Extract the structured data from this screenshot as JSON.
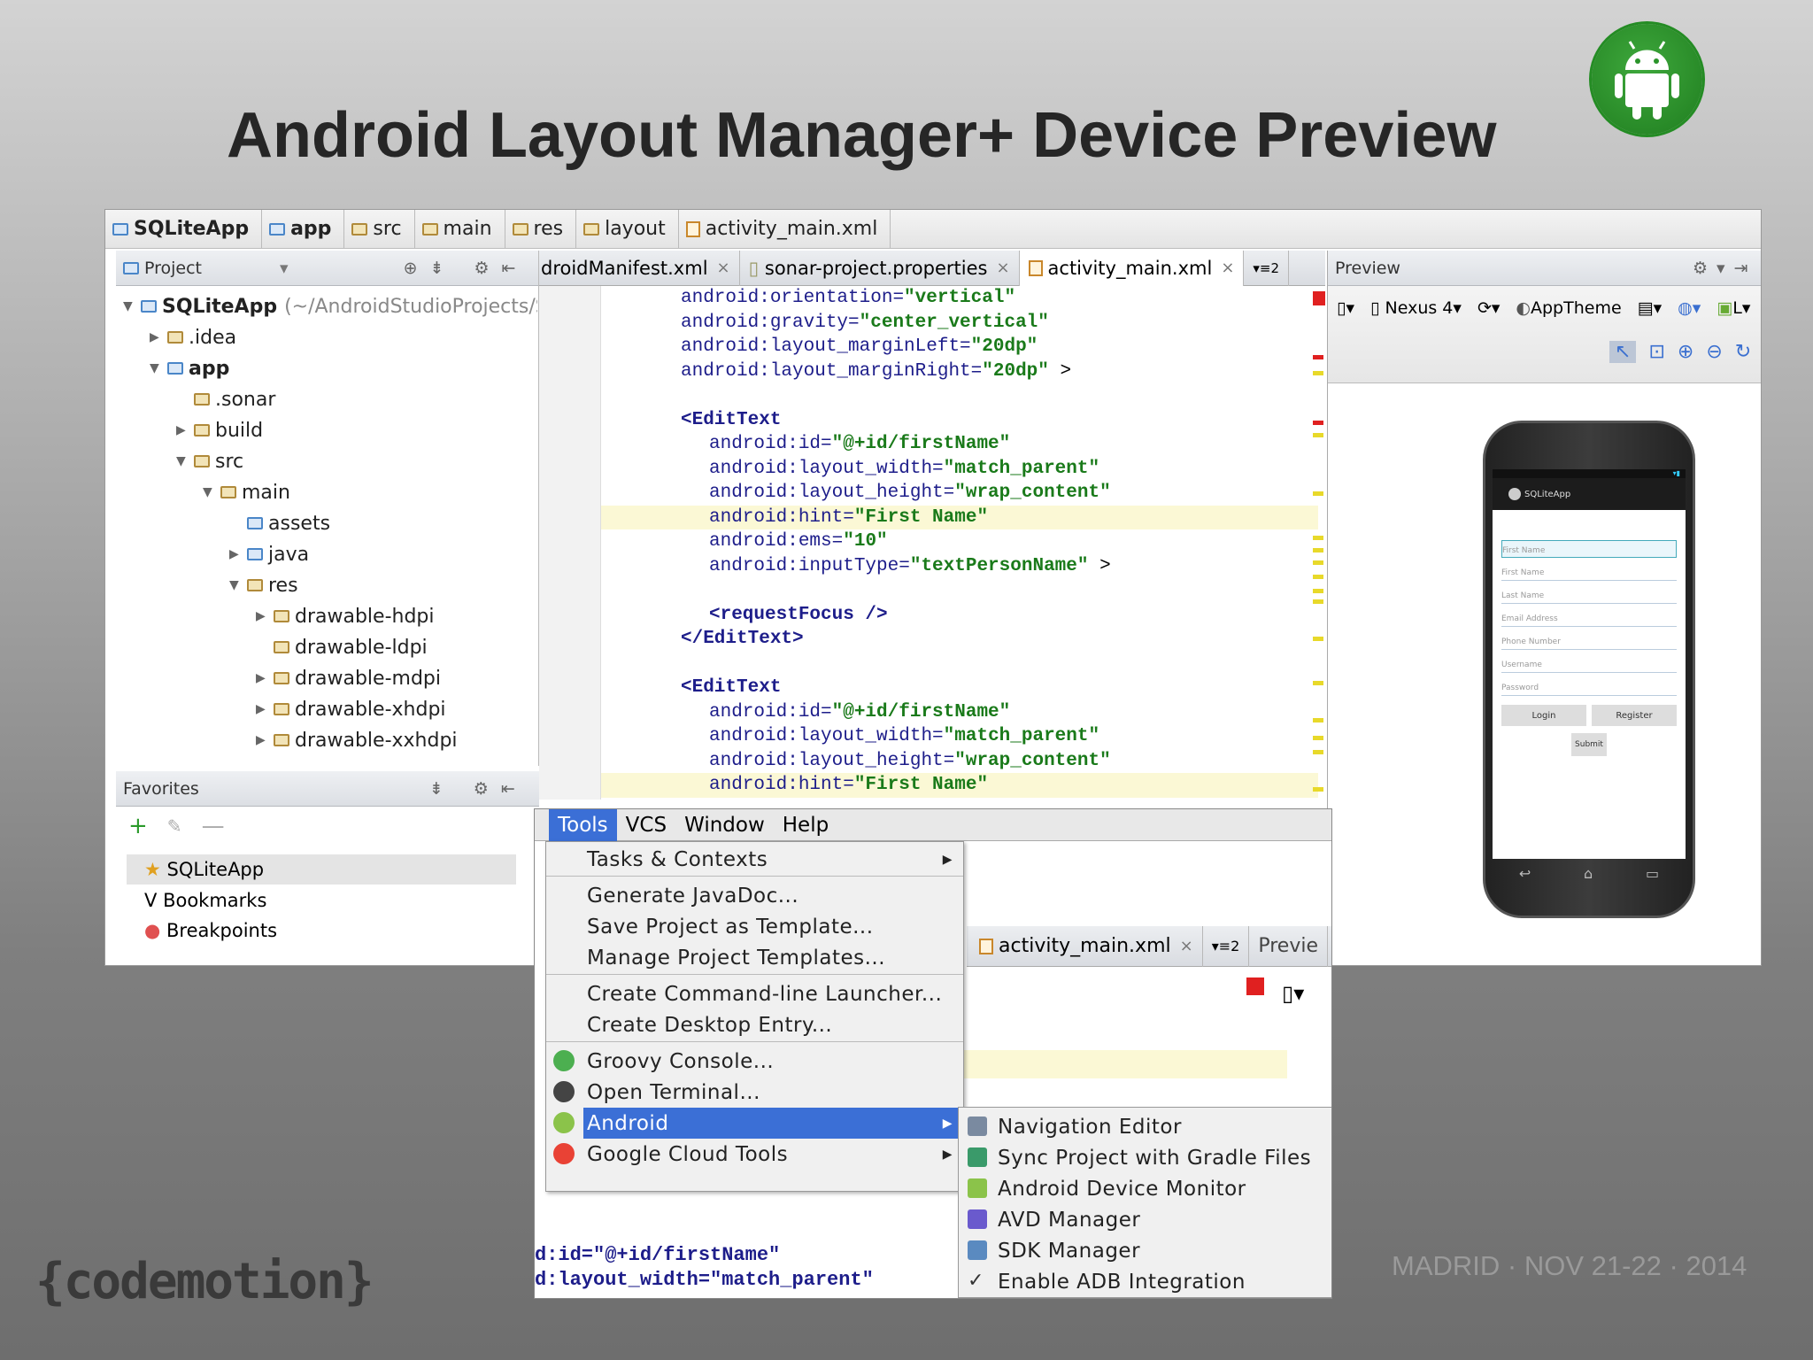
{
  "slide": {
    "title": "Android Layout Manager+ Device Preview",
    "brand": "{codemotion}",
    "event": "MADRID · NOV 21-22 · 2014"
  },
  "breadcrumb": [
    "SQLiteApp",
    "app",
    "src",
    "main",
    "res",
    "layout",
    "activity_main.xml"
  ],
  "project_panel": {
    "header": "Project",
    "tree": [
      {
        "label": "SQLiteApp",
        "extra": "(~/AndroidStudioProjects/SQLit",
        "indent": 0,
        "arrow": "▼",
        "bold": true
      },
      {
        "label": ".idea",
        "indent": 1,
        "arrow": "▶"
      },
      {
        "label": "app",
        "indent": 1,
        "arrow": "▼",
        "bold": true
      },
      {
        "label": ".sonar",
        "indent": 2,
        "arrow": ""
      },
      {
        "label": "build",
        "indent": 2,
        "arrow": "▶"
      },
      {
        "label": "src",
        "indent": 2,
        "arrow": "▼"
      },
      {
        "label": "main",
        "indent": 3,
        "arrow": "▼"
      },
      {
        "label": "assets",
        "indent": 4,
        "arrow": ""
      },
      {
        "label": "java",
        "indent": 4,
        "arrow": "▶"
      },
      {
        "label": "res",
        "indent": 4,
        "arrow": "▼"
      },
      {
        "label": "drawable-hdpi",
        "indent": 5,
        "arrow": "▶"
      },
      {
        "label": "drawable-ldpi",
        "indent": 5,
        "arrow": ""
      },
      {
        "label": "drawable-mdpi",
        "indent": 5,
        "arrow": "▶"
      },
      {
        "label": "drawable-xhdpi",
        "indent": 5,
        "arrow": "▶"
      },
      {
        "label": "drawable-xxhdpi",
        "indent": 5,
        "arrow": "▶"
      }
    ]
  },
  "favorites": {
    "header": "Favorites",
    "items": [
      "SQLiteApp",
      "Bookmarks",
      "Breakpoints"
    ]
  },
  "editor": {
    "tabs": [
      "droidManifest.xml",
      "sonar-project.properties",
      "activity_main.xml"
    ],
    "tab_overflow": "2",
    "lines": [
      {
        "k": "android:orientation=",
        "v": "\"vertical\"",
        "i": 0,
        "t": ""
      },
      {
        "k": "android:gravity=",
        "v": "\"center_vertical\"",
        "i": 0,
        "t": ""
      },
      {
        "k": "android:layout_marginLeft=",
        "v": "\"20dp\"",
        "i": 0,
        "t": ""
      },
      {
        "k": "android:layout_marginRight=",
        "v": "\"20dp\"",
        "i": 0,
        "t": " >"
      },
      {
        "k": "",
        "v": "",
        "i": 0,
        "t": ""
      },
      {
        "k": "<EditText",
        "v": "",
        "i": 0,
        "t": "",
        "tag": true
      },
      {
        "k": "android:id=",
        "v": "\"@+id/firstName\"",
        "i": 1,
        "t": ""
      },
      {
        "k": "android:layout_width=",
        "v": "\"match_parent\"",
        "i": 1,
        "t": ""
      },
      {
        "k": "android:layout_height=",
        "v": "\"wrap_content\"",
        "i": 1,
        "t": ""
      },
      {
        "k": "android:hint=",
        "v": "\"First Name\"",
        "i": 1,
        "t": "",
        "hl": true
      },
      {
        "k": "android:ems=",
        "v": "\"10\"",
        "i": 1,
        "t": ""
      },
      {
        "k": "android:inputType=",
        "v": "\"textPersonName\"",
        "i": 1,
        "t": " >"
      },
      {
        "k": "",
        "v": "",
        "i": 0,
        "t": ""
      },
      {
        "k": "<requestFocus />",
        "v": "",
        "i": 1,
        "t": "",
        "tag": true
      },
      {
        "k": "</EditText>",
        "v": "",
        "i": 0,
        "t": "",
        "tag": true
      },
      {
        "k": "",
        "v": "",
        "i": 0,
        "t": ""
      },
      {
        "k": "<EditText",
        "v": "",
        "i": 0,
        "t": "",
        "tag": true
      },
      {
        "k": "android:id=",
        "v": "\"@+id/firstName\"",
        "i": 1,
        "t": ""
      },
      {
        "k": "android:layout_width=",
        "v": "\"match_parent\"",
        "i": 1,
        "t": ""
      },
      {
        "k": "android:layout_height=",
        "v": "\"wrap_content\"",
        "i": 1,
        "t": ""
      },
      {
        "k": "android:hint=",
        "v": "\"First Name\"",
        "i": 1,
        "t": "",
        "hl": true
      }
    ]
  },
  "preview": {
    "header": "Preview",
    "device": "Nexus 4",
    "theme": "AppTheme",
    "api": "L",
    "app_title": "SQLiteApp",
    "fields": [
      "First Name",
      "First Name",
      "Last Name",
      "Email Address",
      "Phone Number",
      "Username",
      "Password"
    ],
    "buttons": [
      "Login",
      "Register"
    ],
    "submit": "Submit"
  },
  "overlay": {
    "menubar": [
      "Tools",
      "VCS",
      "Window",
      "Help"
    ],
    "tools_menu": [
      {
        "label": "Tasks & Contexts",
        "sub": true
      },
      {
        "label": "Generate JavaDoc..."
      },
      {
        "label": "Save Project as Template..."
      },
      {
        "label": "Manage Project Templates..."
      },
      {
        "label": "Create Command-line Launcher..."
      },
      {
        "label": "Create Desktop Entry..."
      },
      {
        "label": "Groovy Console..."
      },
      {
        "label": "Open Terminal..."
      },
      {
        "label": "Android",
        "sub": true
      },
      {
        "label": "Google Cloud Tools",
        "sub": true
      }
    ],
    "android_submenu": [
      "Navigation Editor",
      "Sync Project with Gradle Files",
      "Android Device Monitor",
      "AVD Manager",
      "SDK Manager",
      "Enable ADB Integration"
    ],
    "tab": "activity_main.xml",
    "tab_overflow": "2",
    "preview_label": "Previe",
    "code": [
      "d:id=\"@+id/firstName\"",
      "d:layout_width=\"match_parent\""
    ]
  }
}
